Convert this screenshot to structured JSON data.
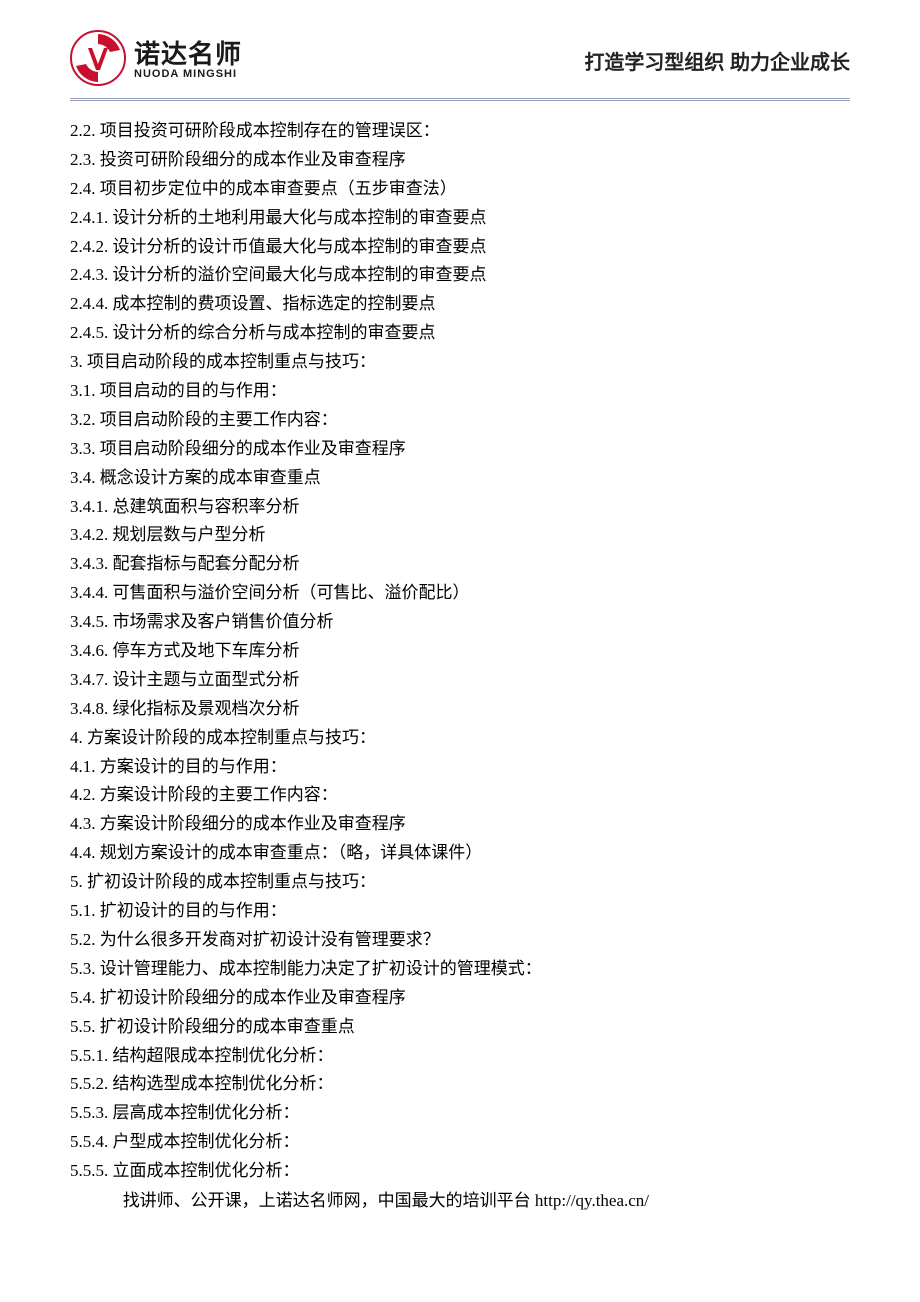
{
  "header": {
    "logo_cn": "诺达名师",
    "logo_en": "NUODA MINGSHI",
    "slogan": "打造学习型组织 助力企业成长"
  },
  "lines": [
    "2.2. 项目投资可研阶段成本控制存在的管理误区：",
    "2.3. 投资可研阶段细分的成本作业及审查程序",
    "2.4. 项目初步定位中的成本审查要点（五步审查法）",
    "2.4.1. 设计分析的土地利用最大化与成本控制的审查要点",
    "2.4.2. 设计分析的设计币值最大化与成本控制的审查要点",
    "2.4.3. 设计分析的溢价空间最大化与成本控制的审查要点",
    "2.4.4. 成本控制的费项设置、指标选定的控制要点",
    "2.4.5. 设计分析的综合分析与成本控制的审查要点",
    "3. 项目启动阶段的成本控制重点与技巧：",
    "3.1. 项目启动的目的与作用：",
    "3.2. 项目启动阶段的主要工作内容：",
    "3.3. 项目启动阶段细分的成本作业及审查程序",
    "3.4. 概念设计方案的成本审查重点",
    "3.4.1. 总建筑面积与容积率分析",
    "3.4.2. 规划层数与户型分析",
    "3.4.3. 配套指标与配套分配分析",
    "3.4.4. 可售面积与溢价空间分析（可售比、溢价配比）",
    "3.4.5. 市场需求及客户销售价值分析",
    "3.4.6. 停车方式及地下车库分析",
    "3.4.7. 设计主题与立面型式分析",
    "3.4.8. 绿化指标及景观档次分析",
    "4. 方案设计阶段的成本控制重点与技巧：",
    "4.1. 方案设计的目的与作用：",
    "4.2. 方案设计阶段的主要工作内容：",
    "4.3. 方案设计阶段细分的成本作业及审查程序",
    "4.4. 规划方案设计的成本审查重点：（略，详具体课件）",
    "5. 扩初设计阶段的成本控制重点与技巧：",
    "5.1. 扩初设计的目的与作用：",
    "5.2. 为什么很多开发商对扩初设计没有管理要求？",
    "5.3. 设计管理能力、成本控制能力决定了扩初设计的管理模式：",
    "5.4. 扩初设计阶段细分的成本作业及审查程序",
    "5.5. 扩初设计阶段细分的成本审查重点",
    "5.5.1. 结构超限成本控制优化分析：",
    "5.5.2. 结构选型成本控制优化分析：",
    "5.5.3. 层高成本控制优化分析：",
    "5.5.4. 户型成本控制优化分析：",
    "5.5.5. 立面成本控制优化分析："
  ],
  "footer": "找讲师、公开课，上诺达名师网，中国最大的培训平台  http://qy.thea.cn/"
}
